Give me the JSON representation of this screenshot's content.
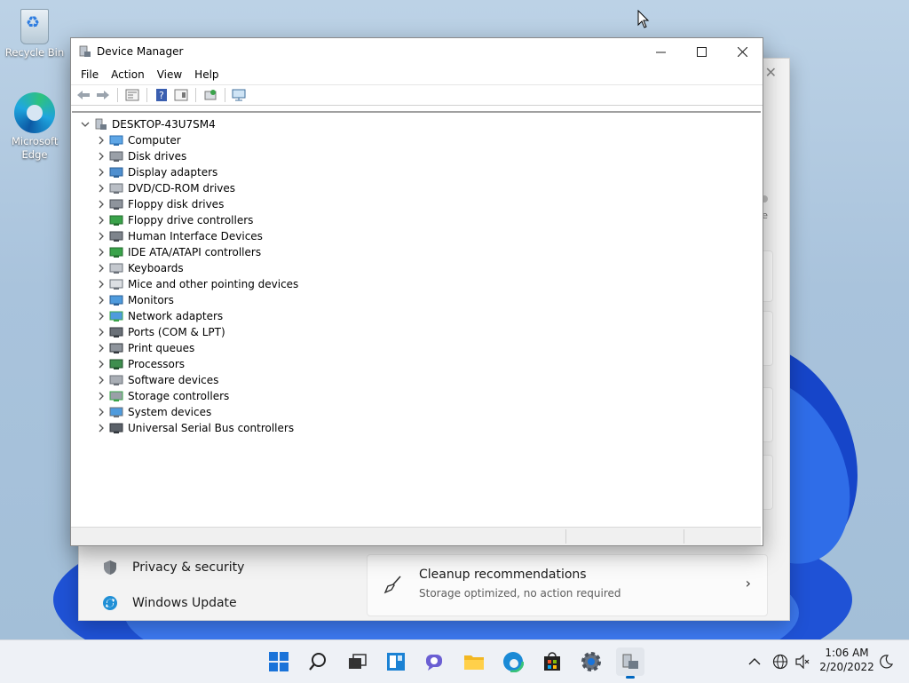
{
  "desktop": {
    "icons": [
      {
        "label": "Recycle Bin",
        "icon": "recycle-bin-icon"
      },
      {
        "label": "Microsoft Edge",
        "icon": "edge-icon"
      }
    ]
  },
  "settings_bg": {
    "nav": [
      {
        "label": "Privacy & security",
        "icon": "shield-icon"
      },
      {
        "label": "Windows Update",
        "icon": "update-icon"
      }
    ],
    "cleanup": {
      "title": "Cleanup recommendations",
      "subtitle": "Storage optimized, no action required",
      "icon": "broom-icon"
    }
  },
  "device_manager": {
    "title": "Device Manager",
    "menu": [
      "File",
      "Action",
      "View",
      "Help"
    ],
    "toolbar": [
      "back-icon",
      "forward-icon",
      "properties-icon",
      "help-icon",
      "view-icon",
      "update-driver-icon",
      "scan-hardware-icon"
    ],
    "root": "DESKTOP-43U7SM4",
    "categories": [
      {
        "label": "Computer",
        "icon": "computer-icon"
      },
      {
        "label": "Disk drives",
        "icon": "disk-drive-icon"
      },
      {
        "label": "Display adapters",
        "icon": "display-adapter-icon"
      },
      {
        "label": "DVD/CD-ROM drives",
        "icon": "dvd-drive-icon"
      },
      {
        "label": "Floppy disk drives",
        "icon": "floppy-drive-icon"
      },
      {
        "label": "Floppy drive controllers",
        "icon": "floppy-controller-icon"
      },
      {
        "label": "Human Interface Devices",
        "icon": "hid-icon"
      },
      {
        "label": "IDE ATA/ATAPI controllers",
        "icon": "ide-controller-icon"
      },
      {
        "label": "Keyboards",
        "icon": "keyboard-icon"
      },
      {
        "label": "Mice and other pointing devices",
        "icon": "mouse-icon"
      },
      {
        "label": "Monitors",
        "icon": "monitor-icon"
      },
      {
        "label": "Network adapters",
        "icon": "network-adapter-icon"
      },
      {
        "label": "Ports (COM & LPT)",
        "icon": "port-icon"
      },
      {
        "label": "Print queues",
        "icon": "printer-icon"
      },
      {
        "label": "Processors",
        "icon": "processor-icon"
      },
      {
        "label": "Software devices",
        "icon": "software-device-icon"
      },
      {
        "label": "Storage controllers",
        "icon": "storage-controller-icon"
      },
      {
        "label": "System devices",
        "icon": "system-device-icon"
      },
      {
        "label": "Universal Serial Bus controllers",
        "icon": "usb-icon"
      }
    ]
  },
  "taskbar": {
    "apps": [
      "start-icon",
      "search-icon",
      "task-view-icon",
      "widgets-icon",
      "chat-icon",
      "file-explorer-icon",
      "edge-icon",
      "store-icon",
      "settings-icon",
      "device-manager-icon"
    ],
    "clock": {
      "time": "1:06 AM",
      "date": "2/20/2022"
    }
  },
  "colors": {
    "accent": "#0067c0",
    "wallpaper": "#a9c3dc",
    "bloom": "#1f52d6"
  }
}
